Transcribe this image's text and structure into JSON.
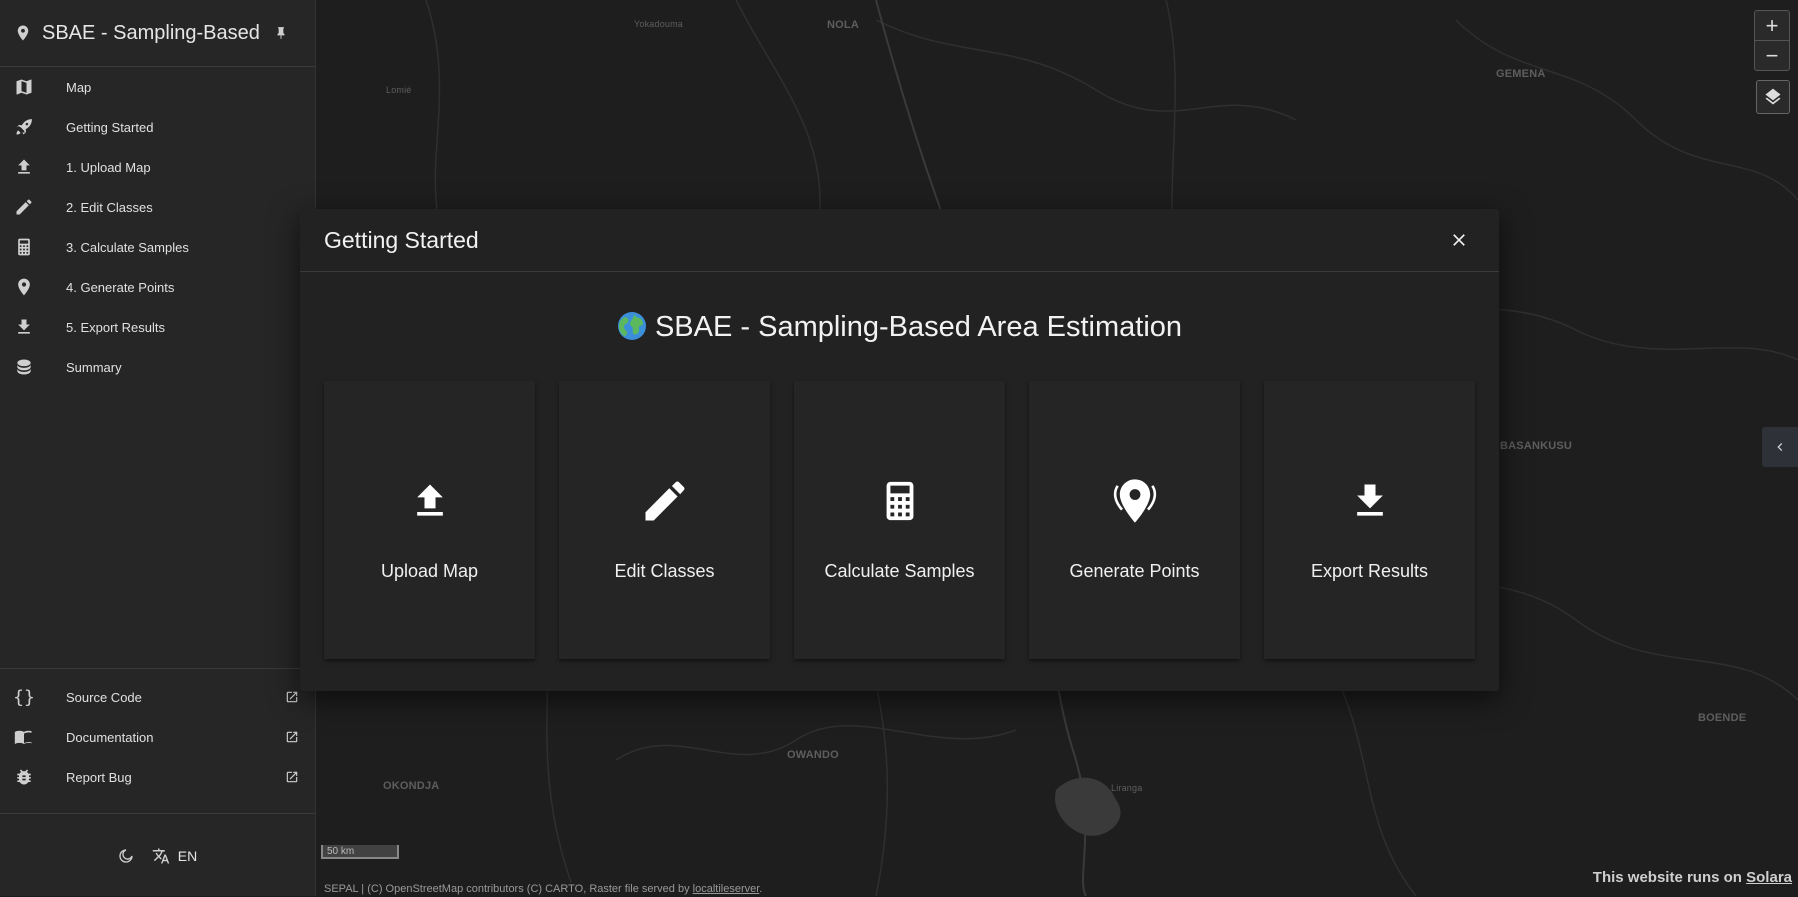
{
  "app": {
    "title": "SBAE - Sampling-Based",
    "nav": [
      {
        "label": "Map",
        "icon": "map-icon"
      },
      {
        "label": "Getting Started",
        "icon": "rocket-icon"
      },
      {
        "label": "1. Upload Map",
        "icon": "upload-icon"
      },
      {
        "label": "2. Edit Classes",
        "icon": "pencil-icon"
      },
      {
        "label": "3. Calculate Samples",
        "icon": "calculator-icon"
      },
      {
        "label": "4. Generate Points",
        "icon": "map-marker-icon"
      },
      {
        "label": "5. Export Results",
        "icon": "download-icon"
      },
      {
        "label": "Summary",
        "icon": "database-icon"
      }
    ],
    "links": [
      {
        "label": "Source Code",
        "icon": "code-braces-icon"
      },
      {
        "label": "Documentation",
        "icon": "book-icon"
      },
      {
        "label": "Report Bug",
        "icon": "bug-icon"
      }
    ],
    "language": "EN"
  },
  "dialog": {
    "title": "Getting Started",
    "heading": "SBAE - Sampling-Based Area Estimation",
    "cards": [
      {
        "label": "Upload Map",
        "icon": "upload-icon"
      },
      {
        "label": "Edit Classes",
        "icon": "pencil-icon"
      },
      {
        "label": "Calculate Samples",
        "icon": "calculator-icon"
      },
      {
        "label": "Generate Points",
        "icon": "map-marker-icon"
      },
      {
        "label": "Export Results",
        "icon": "download-icon"
      }
    ]
  },
  "map": {
    "places": [
      "Yokadouma",
      "NOLA",
      "Lomié",
      "GEMENA",
      "BASANKUSU",
      "OWANDO",
      "OKONDJA",
      "Liranga",
      "BOENDE"
    ],
    "scale": "50 km",
    "attribution_prefix": "SEPAL | (C) OpenStreetMap contributors (C) CARTO, Raster file served by ",
    "attribution_link": "localtileserver",
    "attribution_suffix": ".",
    "solara_prefix": "This website runs on ",
    "solara_link": "Solara"
  }
}
